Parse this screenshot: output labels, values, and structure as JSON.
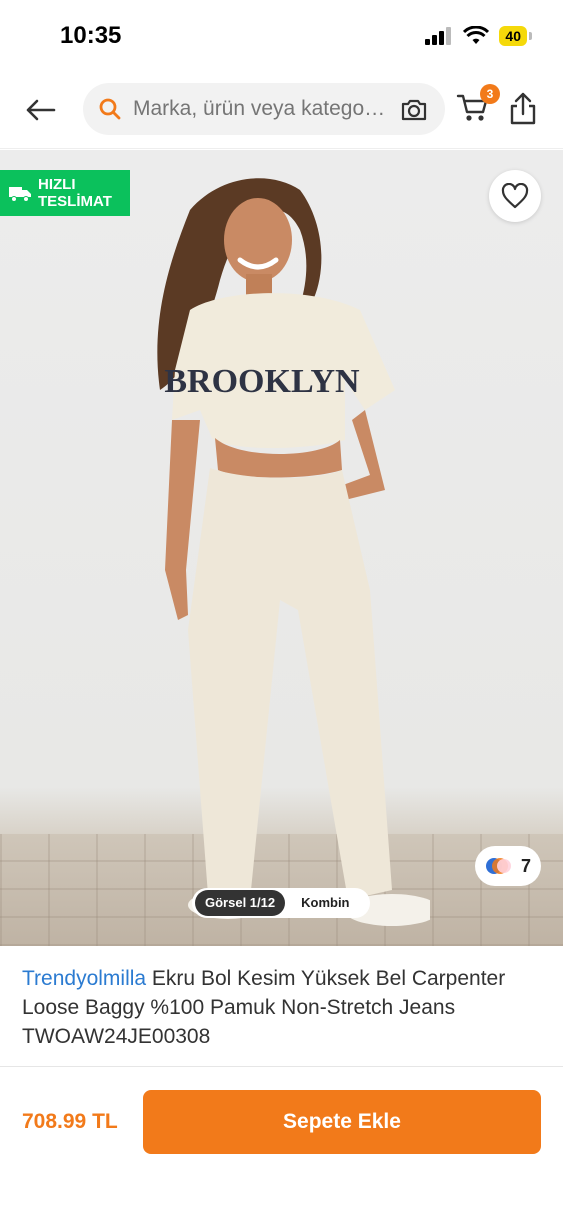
{
  "status_bar": {
    "time": "10:35",
    "battery": "40"
  },
  "header": {
    "search_placeholder": "Marka, ürün veya katego…",
    "cart_count": "3"
  },
  "gallery": {
    "fast_delivery_line1": "HIZLI",
    "fast_delivery_line2": "TESLİMAT",
    "shirt_print": "BROOKLYN",
    "similar_count": "7",
    "tab_image": "Görsel 1/12",
    "tab_combine": "Kombin"
  },
  "product": {
    "brand": "Trendyolmilla",
    "title": " Ekru Bol Kesim Yüksek Bel Carpenter Loose Baggy %100 Pamuk Non-Stretch Jeans TWOAW24JE00308"
  },
  "footer": {
    "price": "708.99 TL",
    "add_to_cart": "Sepete Ekle"
  },
  "colors": {
    "accent": "#f27a1a",
    "fast": "#0bc15c",
    "brand_link": "#2b7bd1"
  }
}
